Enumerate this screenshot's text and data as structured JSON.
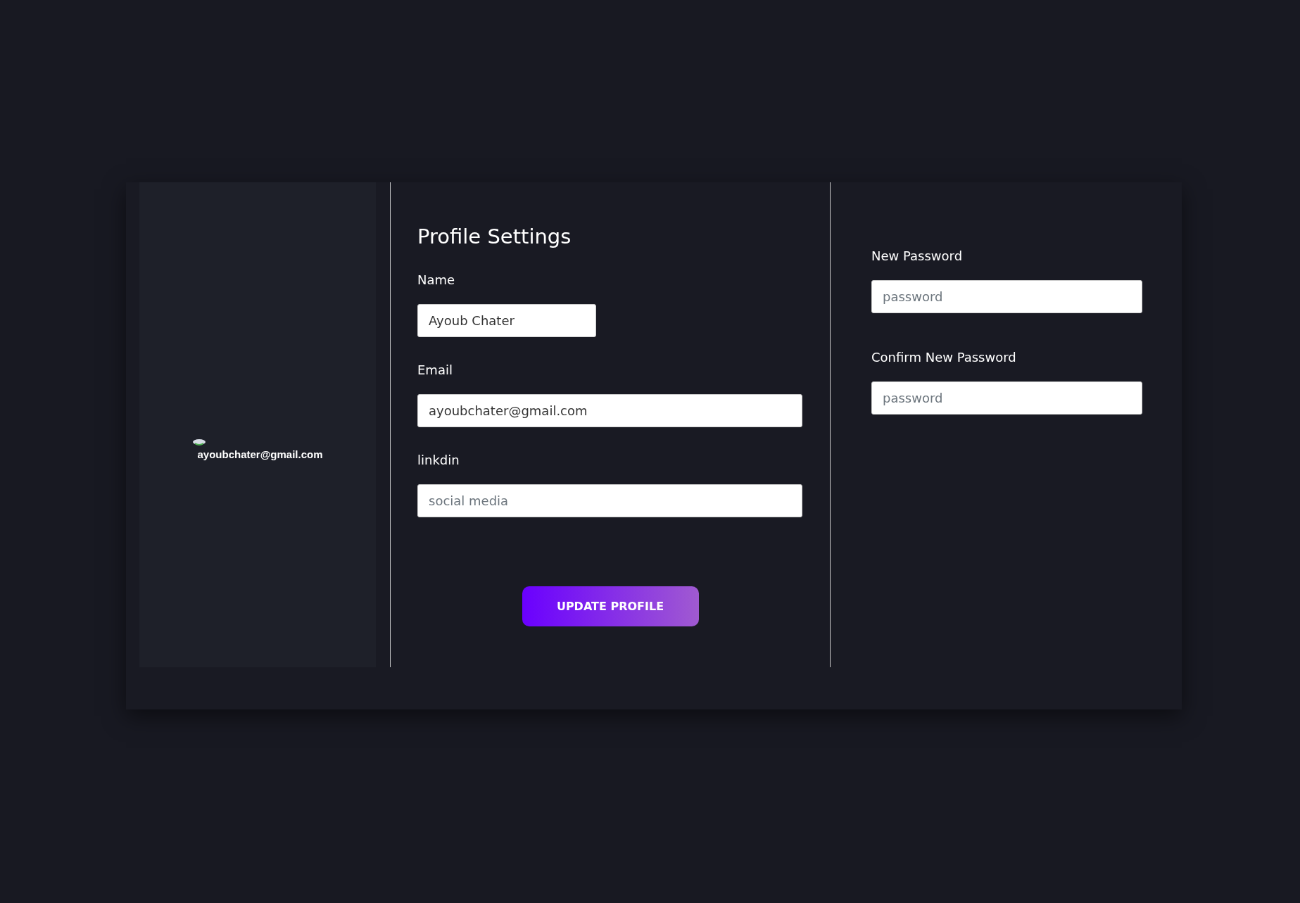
{
  "profile_card": {
    "email": "ayoubchater@gmail.com"
  },
  "profile_settings": {
    "title": "Profile Settings",
    "fields": [
      {
        "label": "Name",
        "value": "Ayoub Chater"
      },
      {
        "label": "Email",
        "value": "ayoubchater@gmail.com"
      },
      {
        "label": "linkdin",
        "placeholder": "social media"
      }
    ],
    "button": "UPDATE PROFILE"
  },
  "password_settings": {
    "fields": [
      {
        "label": "New Password",
        "placeholder": "password"
      },
      {
        "label": "Confirm New Password",
        "placeholder": "password"
      }
    ]
  }
}
